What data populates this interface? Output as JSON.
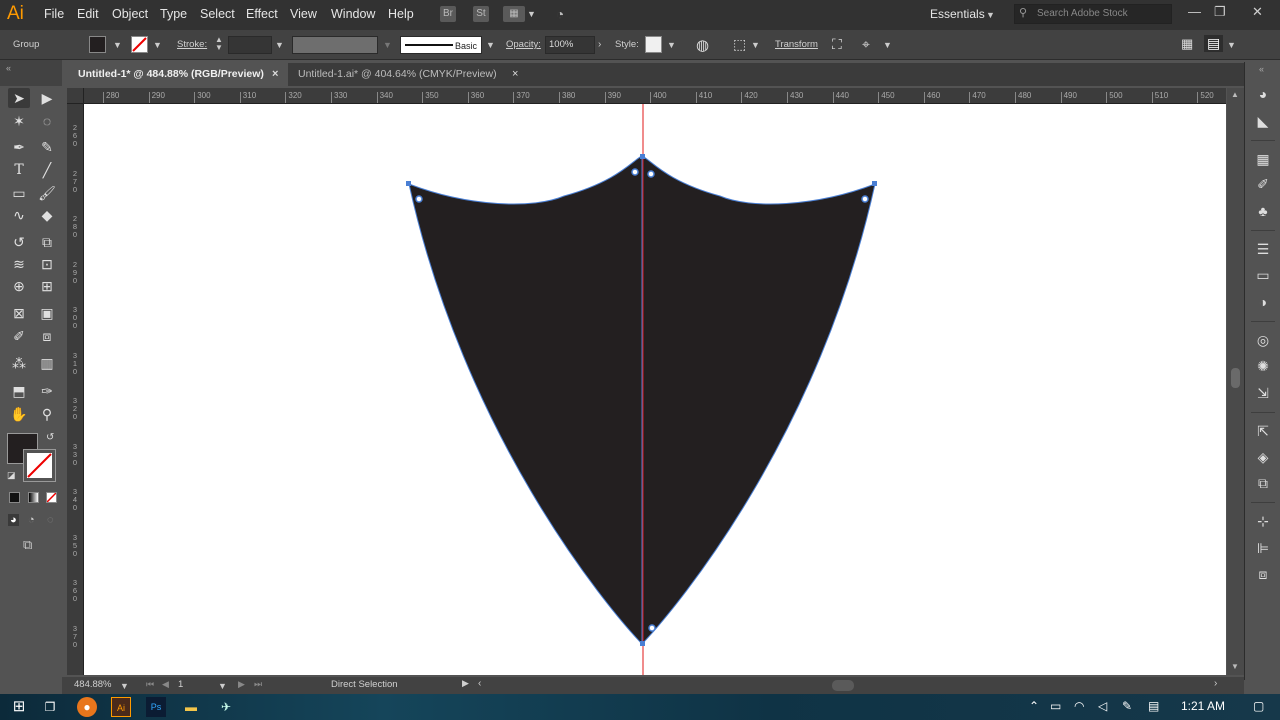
{
  "app": {
    "logo": "Ai",
    "menus": [
      "File",
      "Edit",
      "Object",
      "Type",
      "Select",
      "Effect",
      "View",
      "Window",
      "Help"
    ],
    "workspace": "Essentials",
    "search_placeholder": "Search Adobe Stock",
    "window_controls": [
      "—",
      "❐",
      "✕"
    ]
  },
  "control_bar": {
    "selection_type": "Group",
    "stroke_label": "Stroke:",
    "brush_profile": "Basic",
    "opacity_label": "Opacity:",
    "opacity_value": "100%",
    "style_label": "Style:",
    "transform_label": "Transform"
  },
  "tabs": [
    {
      "title": "Untitled-1* @ 484.88% (RGB/Preview)",
      "active": true
    },
    {
      "title": "Untitled-1.ai* @ 404.64% (CMYK/Preview)",
      "active": false
    }
  ],
  "ruler": {
    "h_ticks": [
      "280",
      "290",
      "300",
      "310",
      "320",
      "330",
      "340",
      "350",
      "360",
      "370",
      "380",
      "390",
      "400",
      "410",
      "420",
      "430",
      "440",
      "450",
      "460",
      "470",
      "480",
      "490",
      "500",
      "510",
      "520"
    ],
    "v_labels": [
      [
        "2",
        "6",
        "0"
      ],
      [
        "2",
        "7",
        "0"
      ],
      [
        "2",
        "8",
        "0"
      ],
      [
        "2",
        "9",
        "0"
      ],
      [
        "3",
        "0",
        "0"
      ],
      [
        "3",
        "1",
        "0"
      ],
      [
        "3",
        "2",
        "0"
      ],
      [
        "3",
        "3",
        "0"
      ],
      [
        "3",
        "4",
        "0"
      ],
      [
        "3",
        "5",
        "0"
      ],
      [
        "3",
        "6",
        "0"
      ],
      [
        "3",
        "7",
        "0"
      ]
    ]
  },
  "status": {
    "zoom": "484.88%",
    "artboard": "1",
    "tool": "Direct Selection"
  },
  "taskbar": {
    "time": "1:21 AM",
    "apps": [
      "windows-start-icon",
      "task-view-icon",
      "firefox-icon",
      "illustrator-icon",
      "photoshop-icon",
      "file-explorer-icon",
      "network-app-icon"
    ]
  },
  "colors": {
    "shield_fill": "#231f20",
    "guide": "#e01818",
    "anchor": "#4a7fd4"
  }
}
